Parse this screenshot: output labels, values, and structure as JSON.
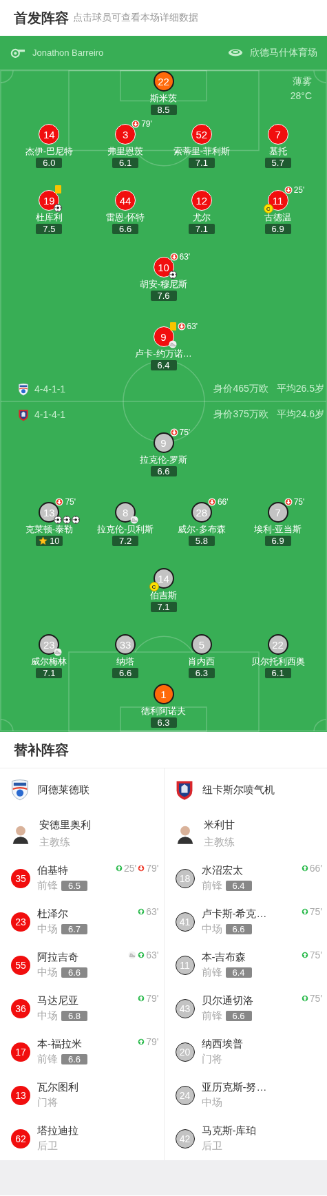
{
  "header": {
    "title": "首发阵容",
    "hint": "点击球员可查看本场详细数据"
  },
  "match_info": {
    "referee": "Jonathon Barreiro",
    "venue": "欣德马什体育场",
    "weather": "薄雾",
    "temperature": "28°C"
  },
  "teams": [
    {
      "kind": "home",
      "formation": "4-4-1-1",
      "market_value": "身价465万欧",
      "average_age": "平均26.5岁",
      "lines": [
        [
          {
            "number": "22",
            "name": "斯米茨",
            "rating": "8.5",
            "kind": "goalkeeper"
          }
        ],
        [
          {
            "number": "14",
            "name": "杰伊-巴尼特",
            "rating": "6.0",
            "kind": "outfield"
          },
          {
            "number": "3",
            "name": "弗里恩茨",
            "rating": "6.1",
            "kind": "outfield",
            "events": [
              {
                "kind": "sub_out",
                "minute": "79'"
              }
            ]
          },
          {
            "number": "52",
            "name": "索蒂里-菲利斯",
            "rating": "7.1",
            "kind": "outfield"
          },
          {
            "number": "7",
            "name": "基托",
            "rating": "5.7",
            "kind": "outfield"
          }
        ],
        [
          {
            "number": "19",
            "name": "杜库利",
            "rating": "7.5",
            "kind": "outfield",
            "events": [
              {
                "kind": "yellow_card"
              },
              {
                "kind": "goal"
              }
            ]
          },
          {
            "number": "44",
            "name": "雷恩-怀特",
            "rating": "6.6",
            "kind": "outfield"
          },
          {
            "number": "12",
            "name": "尤尔",
            "rating": "7.1",
            "kind": "outfield"
          },
          {
            "number": "11",
            "name": "古德温",
            "rating": "6.9",
            "kind": "outfield",
            "captain_badge": "C",
            "events": [
              {
                "kind": "sub_out",
                "minute": "25'"
              }
            ]
          }
        ],
        [
          {
            "number": "10",
            "name": "胡安-穆尼斯",
            "rating": "7.6",
            "kind": "outfield",
            "events": [
              {
                "kind": "sub_out",
                "minute": "63'"
              },
              {
                "kind": "goal"
              }
            ]
          }
        ],
        [
          {
            "number": "9",
            "name": "卢卡-约万诺…",
            "rating": "6.4",
            "kind": "outfield",
            "events": [
              {
                "kind": "yellow_card"
              },
              {
                "kind": "sub_out",
                "minute": "63'"
              },
              {
                "kind": "assist"
              }
            ]
          }
        ]
      ]
    },
    {
      "kind": "away",
      "formation": "4-1-4-1",
      "market_value": "身价375万欧",
      "average_age": "平均24.6岁",
      "lines": [
        [
          {
            "number": "9",
            "name": "拉克伦-罗斯",
            "rating": "6.6",
            "kind": "outfield",
            "events": [
              {
                "kind": "sub_out",
                "minute": "75'"
              }
            ]
          }
        ],
        [
          {
            "number": "13",
            "name": "克莱顿-泰勒",
            "rating": "10",
            "motm": true,
            "kind": "outfield",
            "events": [
              {
                "kind": "sub_out",
                "minute": "75'"
              },
              {
                "kind": "goal"
              },
              {
                "kind": "goal"
              },
              {
                "kind": "goal"
              }
            ]
          },
          {
            "number": "8",
            "name": "拉克伦-贝利斯",
            "rating": "7.2",
            "kind": "outfield",
            "events": [
              {
                "kind": "assist"
              }
            ]
          },
          {
            "number": "28",
            "name": "威尔-多布森",
            "rating": "5.8",
            "kind": "outfield",
            "events": [
              {
                "kind": "sub_out",
                "minute": "66'"
              }
            ]
          },
          {
            "number": "7",
            "name": "埃利-亚当斯",
            "rating": "6.9",
            "kind": "outfield",
            "events": [
              {
                "kind": "sub_out",
                "minute": "75'"
              }
            ]
          }
        ],
        [
          {
            "number": "14",
            "name": "伯吉斯",
            "rating": "7.1",
            "kind": "outfield",
            "captain_badge": "C"
          }
        ],
        [
          {
            "number": "23",
            "name": "威尔梅林",
            "rating": "7.1",
            "kind": "outfield",
            "events": [
              {
                "kind": "assist"
              }
            ]
          },
          {
            "number": "33",
            "name": "纳塔",
            "rating": "6.6",
            "kind": "outfield"
          },
          {
            "number": "5",
            "name": "肖内西",
            "rating": "6.3",
            "kind": "outfield"
          },
          {
            "number": "22",
            "name": "贝尔托利西奥",
            "rating": "6.1",
            "kind": "outfield"
          }
        ],
        [
          {
            "number": "1",
            "name": "德利阿诺夫",
            "rating": "6.3",
            "kind": "goalkeeper"
          }
        ]
      ]
    }
  ],
  "substitutes": {
    "title": "替补阵容",
    "teams": [
      {
        "kind": "home",
        "name": "阿德莱德联",
        "coach": {
          "name": "安德里奥利",
          "role": "主教练"
        },
        "players": [
          {
            "number": "35",
            "name": "伯基特",
            "position": "前锋",
            "rating": "6.5",
            "events": [
              {
                "kind": "sub_in",
                "minute": "25'"
              },
              {
                "kind": "sub_out",
                "minute": "79'"
              }
            ]
          },
          {
            "number": "23",
            "name": "杜泽尔",
            "position": "中场",
            "rating": "6.7",
            "events": [
              {
                "kind": "sub_in",
                "minute": "63'"
              }
            ]
          },
          {
            "number": "55",
            "name": "阿拉吉奇",
            "position": "中场",
            "rating": "6.6",
            "events": [
              {
                "kind": "assist"
              },
              {
                "kind": "sub_in",
                "minute": "63'"
              }
            ]
          },
          {
            "number": "36",
            "name": "马达尼亚",
            "position": "中场",
            "rating": "6.8",
            "events": [
              {
                "kind": "sub_in",
                "minute": "79'"
              }
            ]
          },
          {
            "number": "17",
            "name": "本-福拉米",
            "position": "前锋",
            "rating": "6.6",
            "events": [
              {
                "kind": "sub_in",
                "minute": "79'"
              }
            ]
          },
          {
            "number": "13",
            "name": "瓦尔图利",
            "position": "门将"
          },
          {
            "number": "62",
            "name": "塔拉迪拉",
            "position": "后卫"
          }
        ]
      },
      {
        "kind": "away",
        "name": "纽卡斯尔喷气机",
        "coach": {
          "name": "米利甘",
          "role": "主教练"
        },
        "players": [
          {
            "number": "18",
            "name": "水沼宏太",
            "position": "前锋",
            "rating": "6.4",
            "events": [
              {
                "kind": "sub_in",
                "minute": "66'"
              }
            ]
          },
          {
            "number": "41",
            "name": "卢卡斯-希克…",
            "position": "中场",
            "rating": "6.6",
            "events": [
              {
                "kind": "sub_in",
                "minute": "75'"
              }
            ]
          },
          {
            "number": "11",
            "name": "本-吉布森",
            "position": "前锋",
            "rating": "6.4",
            "events": [
              {
                "kind": "sub_in",
                "minute": "75'"
              }
            ]
          },
          {
            "number": "43",
            "name": "贝尔通切洛",
            "position": "前锋",
            "rating": "6.6",
            "events": [
              {
                "kind": "sub_in",
                "minute": "75'"
              }
            ]
          },
          {
            "number": "20",
            "name": "纳西埃普",
            "position": "门将"
          },
          {
            "number": "24",
            "name": "亚历克斯-努…",
            "position": "中场"
          },
          {
            "number": "42",
            "name": "马克斯-库珀",
            "position": "后卫"
          }
        ]
      }
    ]
  }
}
